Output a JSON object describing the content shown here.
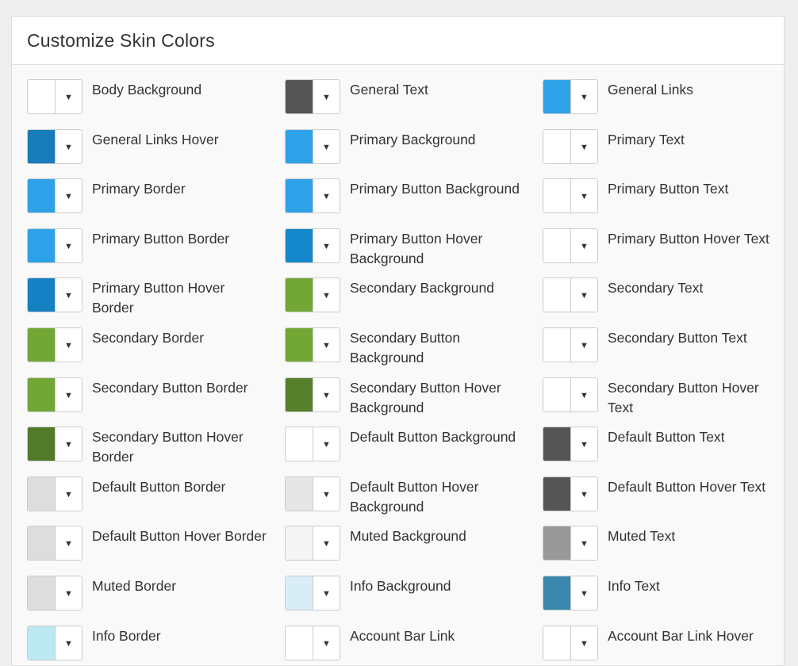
{
  "panel": {
    "title": "Customize Skin Colors"
  },
  "colors": [
    {
      "label": "Body Background",
      "color": "#ffffff"
    },
    {
      "label": "General Text",
      "color": "#555555"
    },
    {
      "label": "General Links",
      "color": "#2ea2e8"
    },
    {
      "label": "General Links Hover",
      "color": "#177cb9"
    },
    {
      "label": "Primary Background",
      "color": "#2ea2e8"
    },
    {
      "label": "Primary Text",
      "color": "#ffffff"
    },
    {
      "label": "Primary Border",
      "color": "#2ea2e8"
    },
    {
      "label": "Primary Button Background",
      "color": "#2ea2e8"
    },
    {
      "label": "Primary Button Text",
      "color": "#ffffff"
    },
    {
      "label": "Primary Button Border",
      "color": "#2ea2e8"
    },
    {
      "label": "Primary Button Hover Background",
      "color": "#1588cc"
    },
    {
      "label": "Primary Button Hover Text",
      "color": "#ffffff"
    },
    {
      "label": "Primary Button Hover Border",
      "color": "#1580c2"
    },
    {
      "label": "Secondary Background",
      "color": "#72a736"
    },
    {
      "label": "Secondary Text",
      "color": "#ffffff"
    },
    {
      "label": "Secondary Border",
      "color": "#72a736"
    },
    {
      "label": "Secondary Button Background",
      "color": "#72a736"
    },
    {
      "label": "Secondary Button Text",
      "color": "#ffffff"
    },
    {
      "label": "Secondary Button Border",
      "color": "#72a736"
    },
    {
      "label": "Secondary Button Hover Background",
      "color": "#56802b"
    },
    {
      "label": "Secondary Button Hover Text",
      "color": "#ffffff"
    },
    {
      "label": "Secondary Button Hover Border",
      "color": "#527a28"
    },
    {
      "label": "Default Button Background",
      "color": "#ffffff"
    },
    {
      "label": "Default Button Text",
      "color": "#555555"
    },
    {
      "label": "Default Button Border",
      "color": "#dddddd"
    },
    {
      "label": "Default Button Hover Background",
      "color": "#e6e6e6"
    },
    {
      "label": "Default Button Hover Text",
      "color": "#555555"
    },
    {
      "label": "Default Button Hover Border",
      "color": "#dddddd"
    },
    {
      "label": "Muted Background",
      "color": "#f5f5f5"
    },
    {
      "label": "Muted Text",
      "color": "#999999"
    },
    {
      "label": "Muted Border",
      "color": "#dddddd"
    },
    {
      "label": "Info Background",
      "color": "#d9edf7"
    },
    {
      "label": "Info Text",
      "color": "#3a87ad"
    },
    {
      "label": "Info Border",
      "color": "#bce8f1"
    },
    {
      "label": "Account Bar Link",
      "color": "#ffffff"
    },
    {
      "label": "Account Bar Link Hover",
      "color": "#ffffff"
    }
  ],
  "icons": {
    "dropdown": "▼"
  }
}
